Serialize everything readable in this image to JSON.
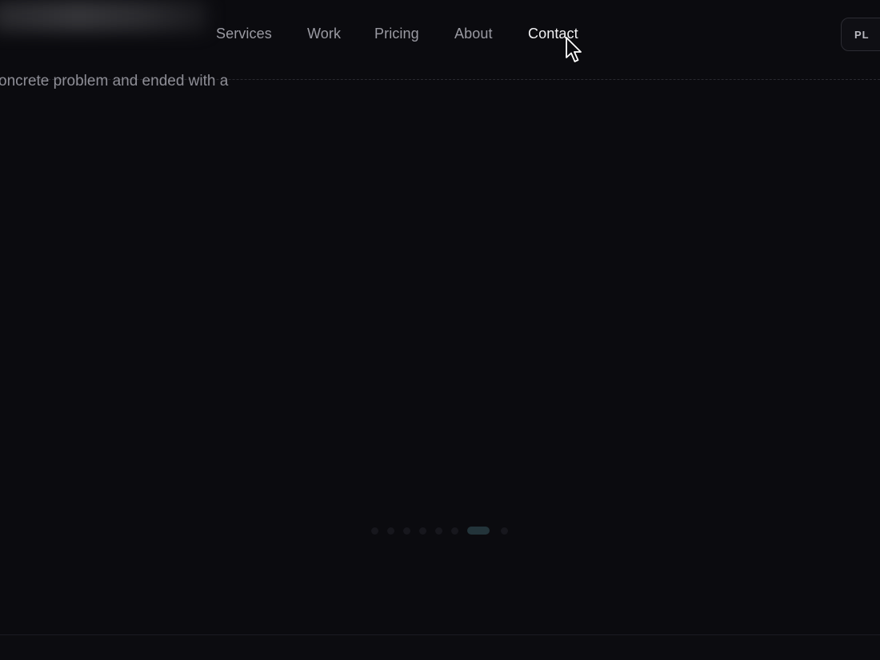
{
  "nav": {
    "items": [
      {
        "label": "Services"
      },
      {
        "label": "Work"
      },
      {
        "label": "Pricing"
      },
      {
        "label": "About"
      },
      {
        "label": "Contact"
      }
    ]
  },
  "lang_button": {
    "label": "PL"
  },
  "body": {
    "text_fragment": "oncrete problem and ended with a"
  },
  "carousel": {
    "total_dots": 8,
    "active_index": 6
  },
  "colors": {
    "background": "#0b0b0f",
    "nav_text": "#9a9aa2",
    "nav_active": "#f2f2f4",
    "active_dot": "#23343a"
  },
  "icons": {
    "cursor": "mouse-pointer-icon"
  }
}
